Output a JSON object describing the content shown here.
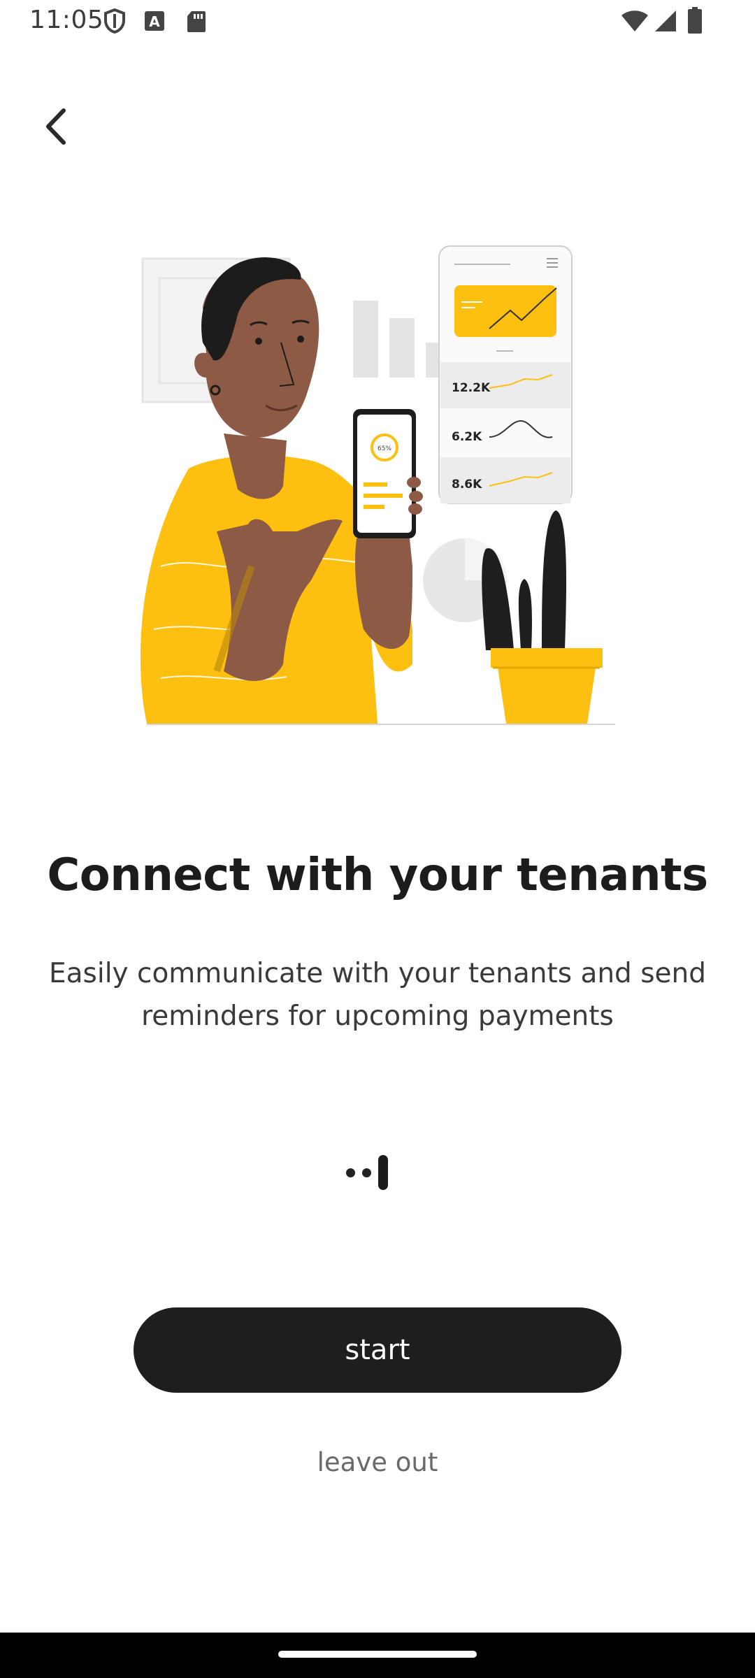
{
  "status_bar": {
    "time": "11:05",
    "icons": [
      "shield-icon",
      "font-a-icon",
      "sd-card-icon",
      "wifi-icon",
      "signal-icon",
      "battery-icon"
    ]
  },
  "navigation": {
    "back_icon": "chevron-left-icon"
  },
  "illustration": {
    "phone_percent": "65%",
    "stats": [
      "12.2K",
      "6.2K",
      "8.6K"
    ]
  },
  "content": {
    "title": "Connect with your tenants",
    "subtitle": "Easily communicate with your tenants and send reminders for upcoming payments"
  },
  "pager": {
    "total_pages": 3,
    "current_page": 3
  },
  "actions": {
    "start_label": "start",
    "leave_out_label": "leave out"
  },
  "colors": {
    "accent_yellow": "#FDC010",
    "button_dark": "#1E1E1E",
    "skin": "#8C5A45"
  }
}
